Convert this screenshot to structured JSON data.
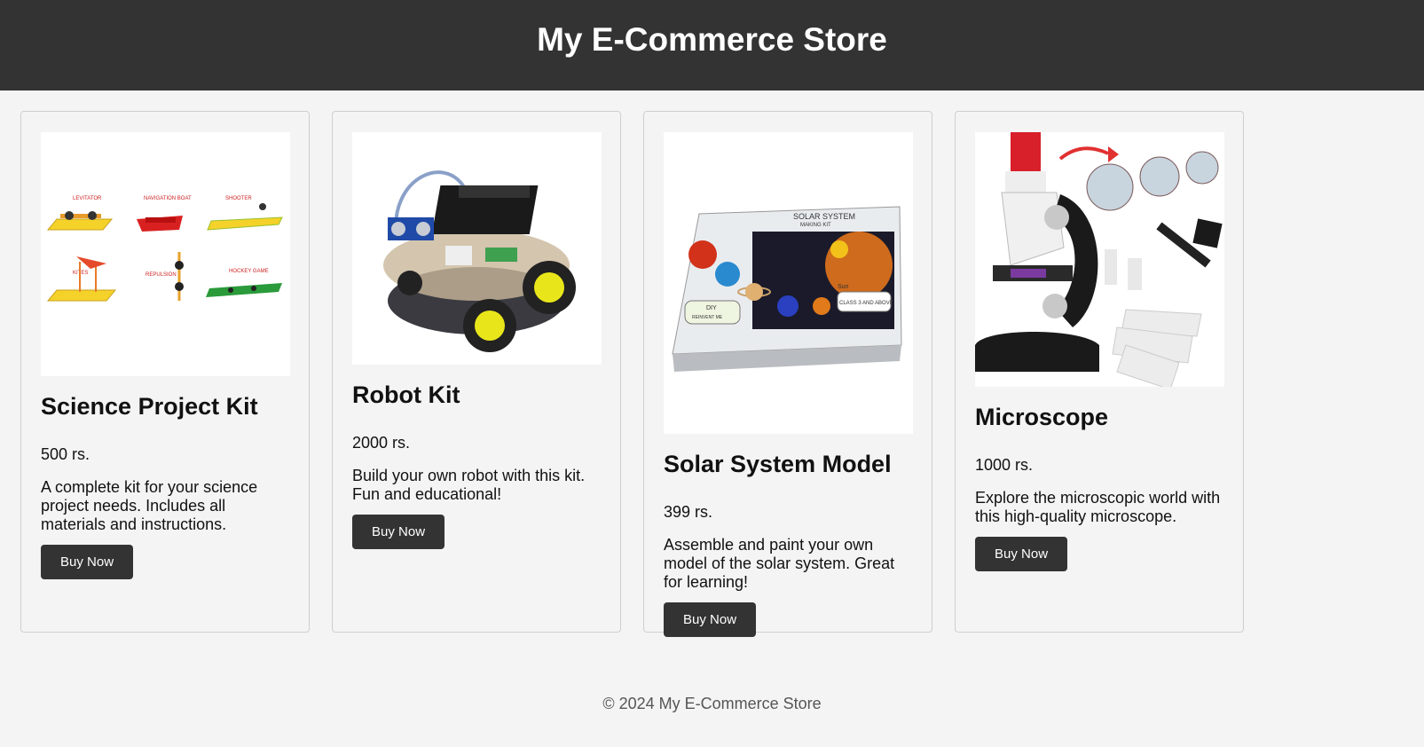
{
  "header": {
    "title": "My E-Commerce Store"
  },
  "products": [
    {
      "name": "Science Project Kit",
      "price": "500 rs.",
      "description": "A complete kit for your science project needs. Includes all materials and instructions.",
      "button_label": "Buy Now",
      "image_labels": [
        "LEVITATOR",
        "NAVIGATION BOAT",
        "SHOOTER",
        "KITES",
        "REPULSION",
        "HOCKEY GAME"
      ]
    },
    {
      "name": "Robot Kit",
      "price": "2000 rs.",
      "description": "Build your own robot with this kit. Fun and educational!",
      "button_label": "Buy Now"
    },
    {
      "name": "Solar System Model",
      "price": "399 rs.",
      "description": "Assemble and paint your own model of the solar system. Great for learning!",
      "button_label": "Buy Now",
      "image_labels": [
        "SOLAR SYSTEM",
        "MAKING KIT",
        "DIY",
        "REINVENT ME",
        "CLASS 3 AND ABOVE",
        "Sun"
      ]
    },
    {
      "name": "Microscope",
      "price": "1000 rs.",
      "description": "Explore the microscopic world with this high-quality microscope.",
      "button_label": "Buy Now"
    }
  ],
  "footer": {
    "text": "© 2024 My E-Commerce Store"
  },
  "colors": {
    "header_bg": "#333333",
    "page_bg": "#f4f4f4",
    "button_bg": "#333333"
  }
}
